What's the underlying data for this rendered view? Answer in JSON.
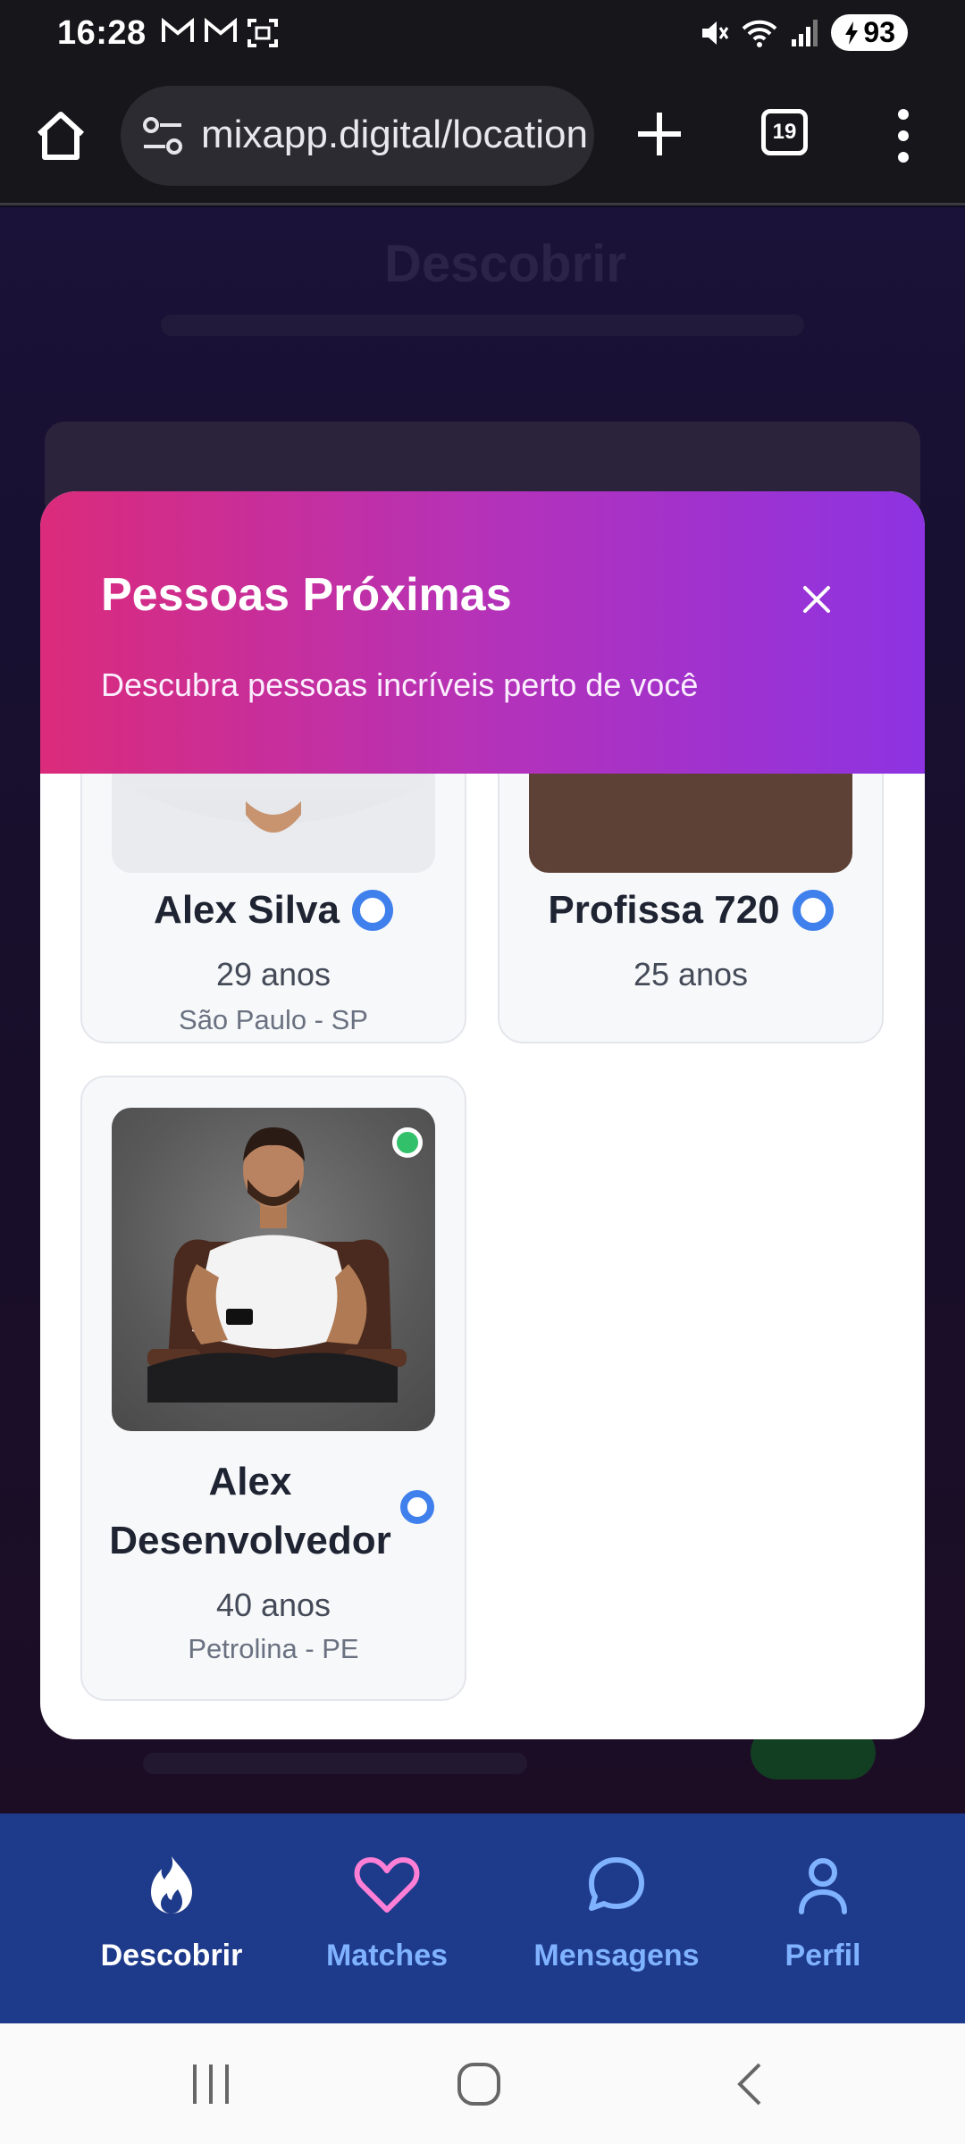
{
  "status_bar": {
    "time": "16:28",
    "battery": "93"
  },
  "browser": {
    "url": "mixapp.digital/location",
    "tab_count": "19"
  },
  "background_page": {
    "title": "Descobrir"
  },
  "modal": {
    "title": "Pessoas Próximas",
    "subtitle": "Descubra pessoas incríveis perto de você",
    "profiles": [
      {
        "name": "Alex Silva",
        "age": "29 anos",
        "city": "São Paulo - SP",
        "verified": true
      },
      {
        "name": "Profissa 720",
        "age": "25 anos",
        "verified": true
      },
      {
        "name": "Alex Desenvolvedor",
        "age": "40 anos",
        "city": "Petrolina - PE",
        "verified": true,
        "online": true
      }
    ]
  },
  "bottom_nav": {
    "items": [
      {
        "label": "Descobrir",
        "icon": "flame-icon"
      },
      {
        "label": "Matches",
        "icon": "heart-icon"
      },
      {
        "label": "Mensagens",
        "icon": "chat-bubble-icon"
      },
      {
        "label": "Perfil",
        "icon": "user-icon"
      }
    ]
  },
  "colors": {
    "header_gradient_start": "#db2b7b",
    "header_gradient_end": "#8d33e2",
    "nav_background": "#1e3a8a",
    "verified_blue": "#3f80ec",
    "online_green": "#33c06a"
  }
}
